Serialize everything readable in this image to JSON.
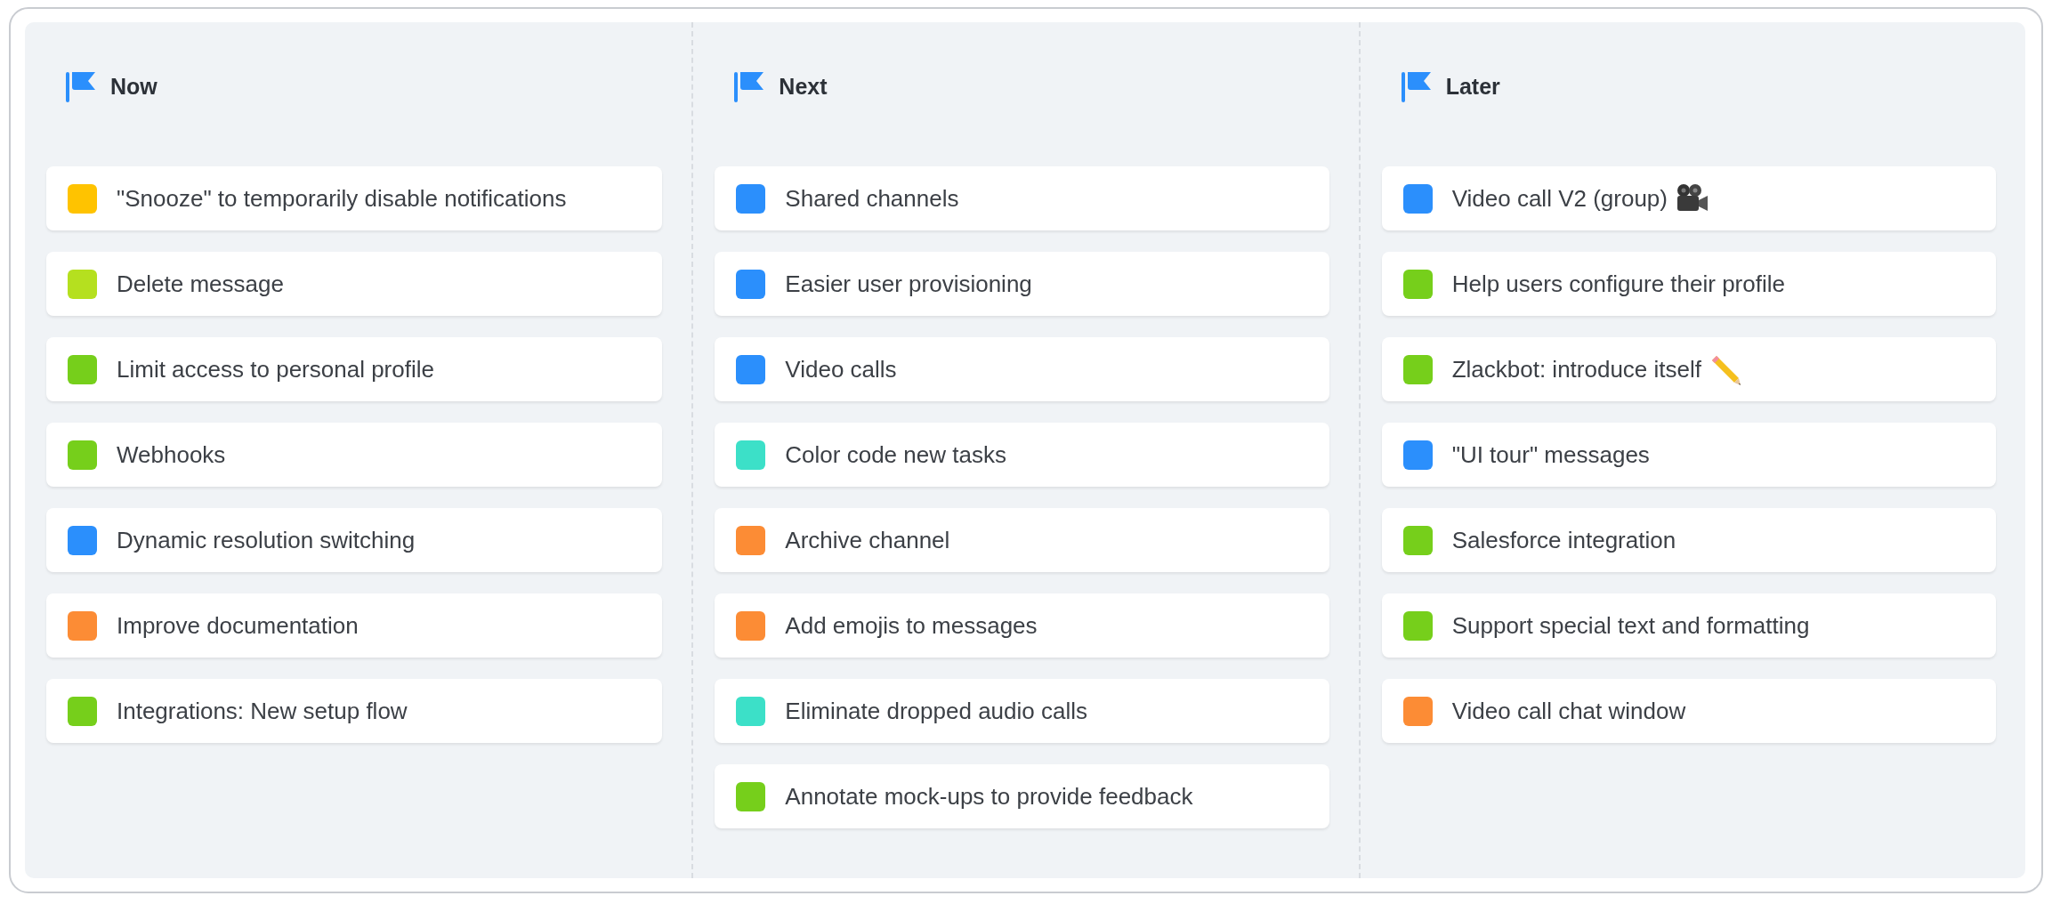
{
  "columns": [
    {
      "title": "Now",
      "items": [
        {
          "label": "\"Snooze\" to temporarily disable notifications",
          "color": "#ffc300"
        },
        {
          "label": "Delete message",
          "color": "#b5e01f"
        },
        {
          "label": "Limit access to personal profile",
          "color": "#76cf1b"
        },
        {
          "label": "Webhooks",
          "color": "#76cf1b"
        },
        {
          "label": "Dynamic resolution switching",
          "color": "#2b8ffc"
        },
        {
          "label": "Improve documentation",
          "color": "#fc8c35"
        },
        {
          "label": "Integrations: New setup flow",
          "color": "#76cf1b"
        }
      ]
    },
    {
      "title": "Next",
      "items": [
        {
          "label": "Shared channels",
          "color": "#2b8ffc"
        },
        {
          "label": "Easier user provisioning",
          "color": "#2b8ffc"
        },
        {
          "label": "Video calls",
          "color": "#2b8ffc"
        },
        {
          "label": "Color code new tasks",
          "color": "#3ce0c8"
        },
        {
          "label": "Archive channel",
          "color": "#fc8c35"
        },
        {
          "label": "Add emojis to messages",
          "color": "#fc8c35"
        },
        {
          "label": "Eliminate dropped audio calls",
          "color": "#3ce0c8"
        },
        {
          "label": "Annotate mock-ups to provide feedback",
          "color": "#76cf1b"
        }
      ]
    },
    {
      "title": "Later",
      "items": [
        {
          "label": "Video call V2 (group)",
          "color": "#2b8ffc",
          "kind": "camera"
        },
        {
          "label": "Help users configure their profile",
          "color": "#76cf1b"
        },
        {
          "label": "Zlackbot: introduce itself",
          "color": "#76cf1b",
          "kind": "pencil"
        },
        {
          "label": "\"UI tour\" messages",
          "color": "#2b8ffc"
        },
        {
          "label": "Salesforce integration",
          "color": "#76cf1b"
        },
        {
          "label": "Support special text and formatting",
          "color": "#76cf1b"
        },
        {
          "label": "Video call chat window",
          "color": "#fc8c35"
        }
      ]
    }
  ]
}
